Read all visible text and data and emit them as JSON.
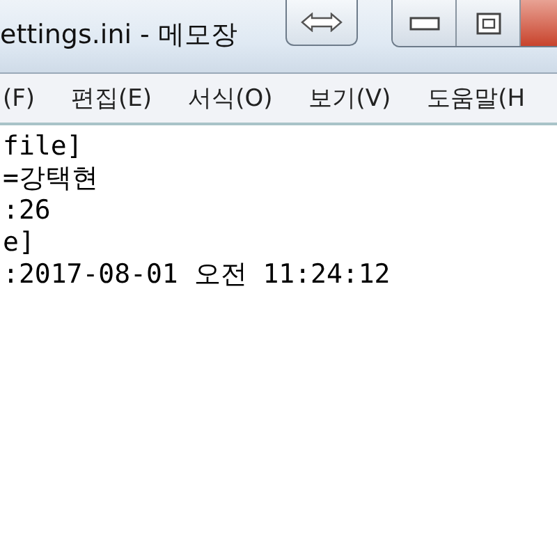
{
  "window": {
    "title": "ettings.ini - 메모장"
  },
  "menu": [
    "(F)",
    "편집(E)",
    "서식(O)",
    "보기(V)",
    "도움말(H"
  ],
  "lines": [
    "file]",
    "=강택현",
    ":26",
    "e]",
    ":2017-08-01 오전 11:24:12"
  ]
}
